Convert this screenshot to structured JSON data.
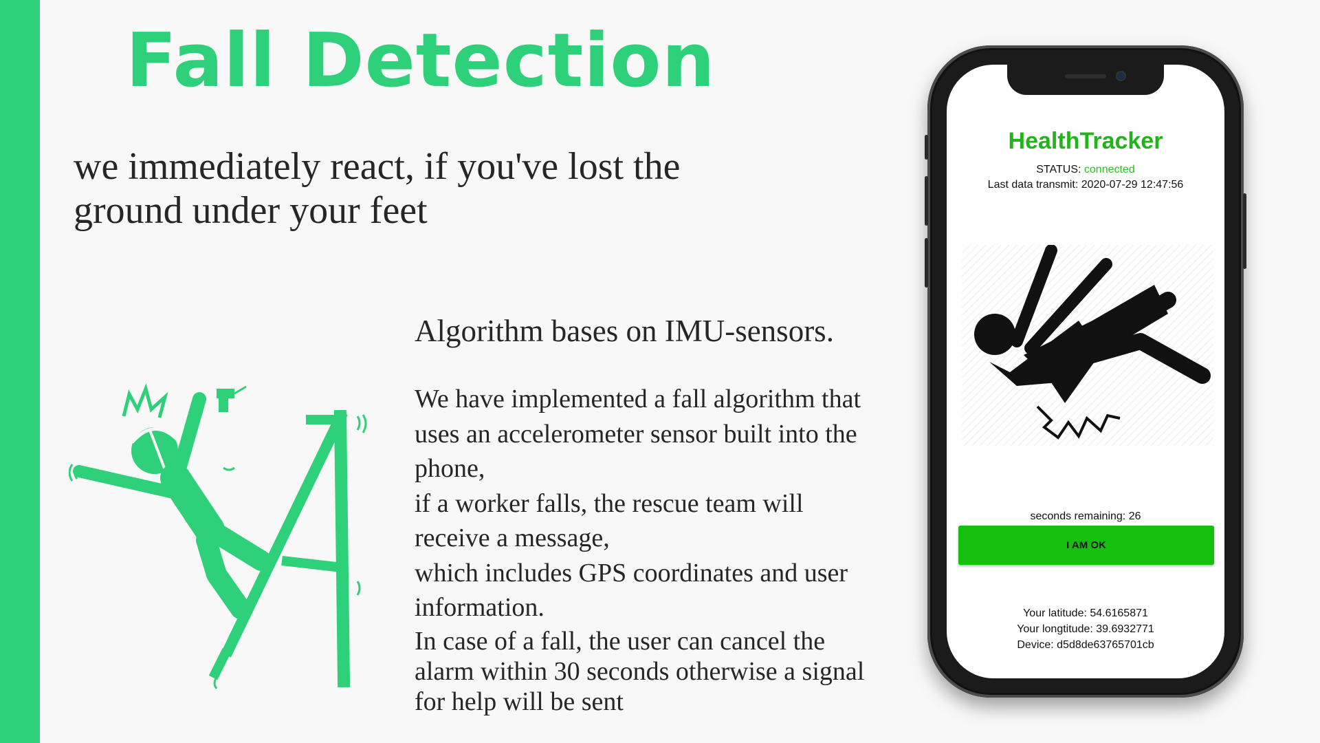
{
  "slide": {
    "title": "Fall Detection",
    "subtitle": "we immediately react, if you've lost the\nground under your feet",
    "algo_heading": "Algorithm bases on IMU-sensors.",
    "description_lines": [
      "We have implemented a fall algorithm that\nuses an accelerometer sensor built into the\nphone,",
      "if a worker falls, the rescue team will\nreceive a message,",
      "which includes GPS coordinates and user\ninformation."
    ],
    "cancel_note": "In case of a fall, the user can cancel the\nalarm within 30 seconds otherwise  a signal\nfor help will be sent",
    "accent_color": "#2ed17a"
  },
  "phone_app": {
    "app_name": "HealthTracker",
    "status_label": "STATUS: ",
    "status_value": "connected",
    "last_transmit": "Last data transmit: 2020-07-29 12:47:56",
    "countdown": "seconds remaining: 26",
    "ok_button": "I AM OK",
    "latitude": "Your latitude: 54.6165871",
    "longitude": "Your longtitude: 39.6932771",
    "device": "Device: d5d8de63765701cb",
    "brand_color": "#22b51b",
    "button_color": "#14c00e"
  },
  "icons": [
    "falling-worker-illustration",
    "falling-person-icon"
  ]
}
